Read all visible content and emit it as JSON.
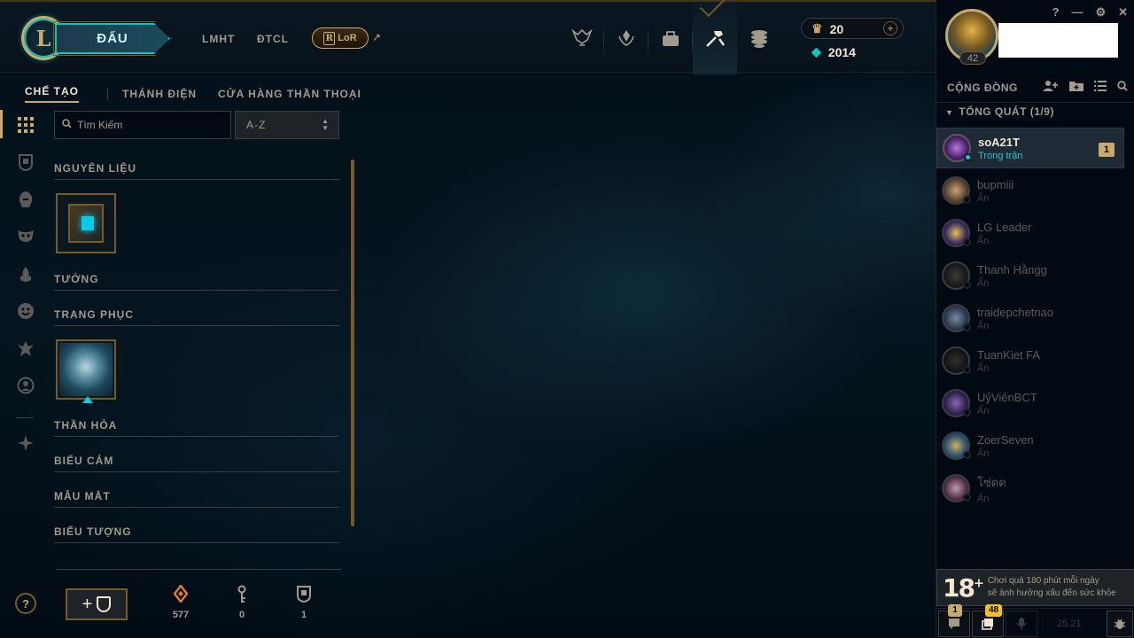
{
  "topbar": {
    "logo_letter": "L",
    "play_label": "ĐẤU",
    "nav": [
      "LMHT",
      "ĐTCL"
    ],
    "lor_label": "LoR",
    "lor_letter": "R",
    "ext_arrow": "↗",
    "icons": [
      "worlds-trophy-icon",
      "ranked-icon",
      "collection-icon",
      "crafting-icon",
      "store-icon"
    ],
    "riot_points": "20",
    "blue_essence": "2014"
  },
  "window": {
    "help": "?",
    "minimize": "—",
    "settings": "⚙",
    "close": "✕"
  },
  "profile": {
    "level": "42"
  },
  "subnav": {
    "tabs": [
      "CHẾ TẠO",
      "THÁNH ĐIỆN",
      "CỬA HÀNG THẦN THOẠI"
    ]
  },
  "crafting": {
    "search_placeholder": "Tìm Kiếm",
    "sort_value": "A-Z",
    "sections": [
      "NGUYÊN LIỆU",
      "TƯỚNG",
      "TRANG PHỤC",
      "THẦN HỎA",
      "BIỂU CẢM",
      "MẪU MẮT",
      "BIỂU TƯỢNG"
    ],
    "add_label": "+",
    "counters": {
      "orange_essence": "577",
      "keys": "0",
      "chests": "1"
    }
  },
  "social": {
    "title": "CỘNG ĐỒNG",
    "group": "TỔNG QUÁT (1/9)",
    "friends": [
      {
        "name": "soA21T",
        "status": "Trong trận",
        "count": "1"
      },
      {
        "name": "bupmiii",
        "status": "Ẩn"
      },
      {
        "name": "LG Leader",
        "status": "Ẩn"
      },
      {
        "name": "Thanh Hằngg",
        "status": "Ẩn"
      },
      {
        "name": "traidepchetnao",
        "status": "Ẩn"
      },
      {
        "name": "TuanKiet FA",
        "status": "Ẩn"
      },
      {
        "name": "UỷViênBCT",
        "status": "Ẩn"
      },
      {
        "name": "ZoerSeven",
        "status": "Ẩn"
      },
      {
        "name": "โซ่ดด",
        "status": "Ẩn"
      }
    ],
    "age_rating": "18",
    "age_warning_line1": "Chơi quá 180 phút mỗi ngày",
    "age_warning_line2": "sẽ ảnh hưởng xấu đến sức khỏe",
    "chat_badge": "1",
    "missions_badge": "48",
    "version": "25.21"
  },
  "colors": {
    "gold": "#c8aa6e",
    "teal": "#0ac8b9",
    "bg": "#010a13"
  }
}
